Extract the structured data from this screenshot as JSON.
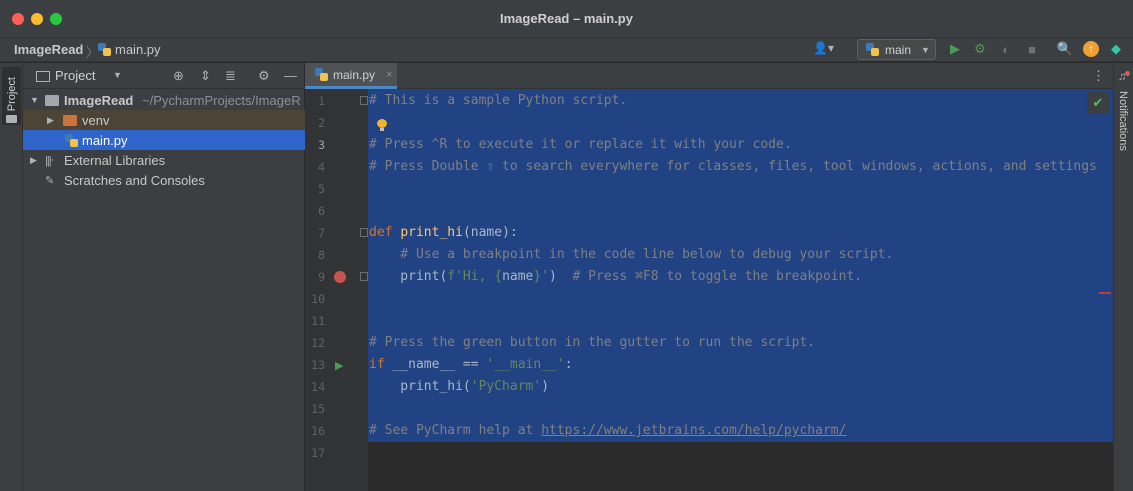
{
  "window": {
    "title": "ImageRead – main.py"
  },
  "navbar": {
    "project": "ImageRead",
    "separator": "〉",
    "file": "main.py",
    "run_config": "main",
    "icons": [
      "user-icon",
      "python-icon",
      "run-icon",
      "debug-icon",
      "coverage-icon",
      "stop-icon",
      "search-icon",
      "update-icon",
      "jetbrains-icon"
    ]
  },
  "left_stripe": {
    "project_tab": "Project"
  },
  "project_panel": {
    "title": "Project",
    "tree": [
      {
        "label": "ImageRead",
        "path": "~/PycharmProjects/ImageR",
        "expanded": true
      },
      {
        "label": "venv",
        "expanded": false
      },
      {
        "label": "main.py",
        "selected": true
      },
      {
        "label": "External Libraries",
        "expanded": false
      },
      {
        "label": "Scratches and Consoles"
      }
    ]
  },
  "editor": {
    "tab_label": "main.py",
    "tab_close": "×",
    "line_numbers": [
      "1",
      "2",
      "3",
      "4",
      "5",
      "6",
      "7",
      "8",
      "9",
      "10",
      "11",
      "12",
      "13",
      "14",
      "15",
      "16",
      "17"
    ],
    "lines": {
      "l1": "# This is a sample Python script.",
      "l3": "# Press ^R to execute it or replace it with your code.",
      "l4": "# Press Double ⇧ to search everywhere for classes, files, tool windows, actions, and settings",
      "l7_kw": "def ",
      "l7_fn": "print_hi",
      "l7_rest": "(name):",
      "l8": "    # Use a breakpoint in the code line below to debug your script.",
      "l9_a": "    print(",
      "l9_b": "f'Hi, {",
      "l9_c": "name",
      "l9_d": "}'",
      "l9_e": ")  ",
      "l9_f": "# Press ⌘F8 to toggle the breakpoint.",
      "l12": "# Press the green button in the gutter to run the script.",
      "l13_kw": "if ",
      "l13_a": "__name__ == ",
      "l13_st": "'__main__'",
      "l13_b": ":",
      "l14_a": "    print_hi(",
      "l14_st": "'PyCharm'",
      "l14_b": ")",
      "l16_a": "# See PyCharm help at ",
      "l16_link": "https://www.jetbrains.com/help/pycharm/"
    }
  },
  "right_stripe": {
    "notifications": "Notifications"
  },
  "colors": {
    "selection": "#214283",
    "accent": "#2f65ca",
    "breakpoint": "#c75450"
  }
}
